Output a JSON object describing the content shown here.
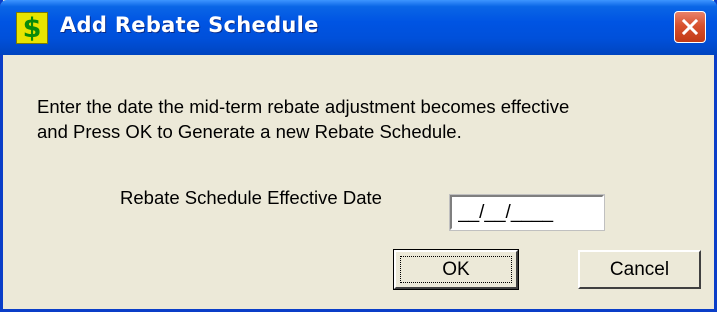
{
  "window": {
    "title": "Add Rebate Schedule",
    "app_icon_glyph": "$",
    "icon_name": "dollar-sign-icon",
    "close_icon_name": "close-icon"
  },
  "dialog": {
    "message_line1": "Enter the date the mid-term rebate adjustment becomes effective",
    "message_line2": "and Press OK to Generate a new Rebate Schedule.",
    "field_label": "Rebate Schedule Effective Date",
    "date_value": "__/__/____"
  },
  "buttons": {
    "ok_label": "OK",
    "cancel_label": "Cancel"
  },
  "colors": {
    "titlebar": "#0054E3",
    "background": "#ECE9D8",
    "close_button": "#D8512E",
    "icon_bg": "#E8E400",
    "icon_glyph": "#0A8A0A"
  }
}
